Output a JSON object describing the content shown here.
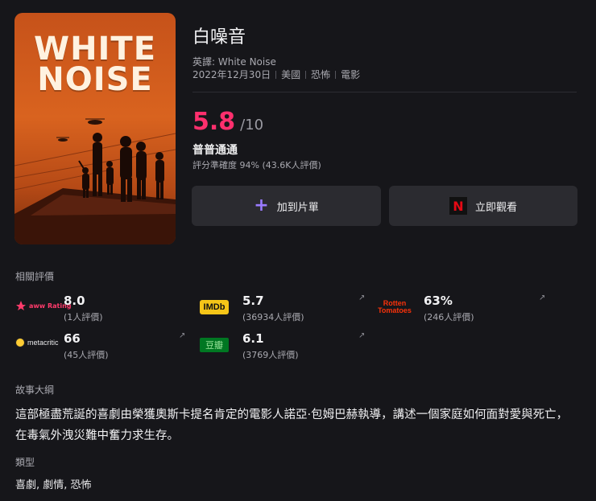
{
  "poster": {
    "title_line1": "WHITE",
    "title_line2": "NOISE"
  },
  "header": {
    "title": "白噪音",
    "english_title": "英譯: White Noise",
    "meta": [
      "2022年12月30日",
      "美國",
      "恐怖",
      "電影"
    ]
  },
  "score": {
    "value": "5.8",
    "out_of": "/10",
    "verdict": "普普通通",
    "accuracy": "評分準確度 94% (43.6K人評價)"
  },
  "buttons": {
    "add_to_list": "加到片單",
    "watch_now": "立即觀看"
  },
  "ratings_section": {
    "label": "相關評價",
    "items": [
      {
        "source": "aww Rating",
        "value": "8.0",
        "count": "(1人評價)"
      },
      {
        "source": "IMDb",
        "value": "5.7",
        "count": "(36934人評價)"
      },
      {
        "source": "Rotten Tomatoes",
        "value": "63%",
        "count": "(246人評價)"
      },
      {
        "source": "metacritic",
        "value": "66",
        "count": "(45人評價)"
      },
      {
        "source": "豆瓣",
        "value": "6.1",
        "count": "(3769人評價)"
      }
    ]
  },
  "synopsis": {
    "label": "故事大綱",
    "text": "這部極盡荒誕的喜劇由榮獲奧斯卡提名肯定的電影人諾亞·包姆巴赫執導，講述一個家庭如何面對愛與死亡，在毒氣外洩災難中奮力求生存。"
  },
  "genre": {
    "label": "類型",
    "text": "喜劇, 劇情, 恐怖"
  },
  "colors": {
    "accent": "#ff2f6d",
    "background": "#16161a",
    "button": "#2b2b30"
  }
}
